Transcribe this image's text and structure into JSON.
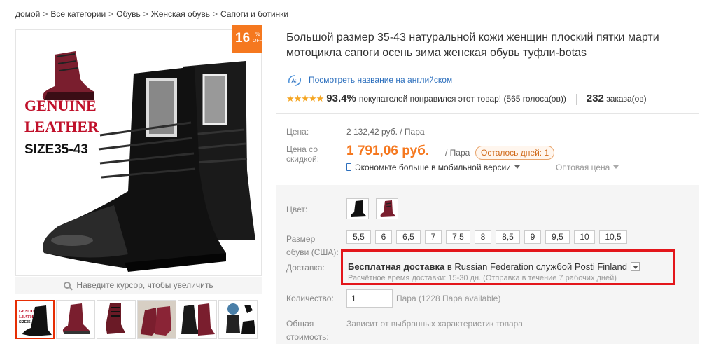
{
  "breadcrumb": [
    "домой",
    "Все категории",
    "Обувь",
    "Женская обувь",
    "Сапоги и ботинки"
  ],
  "product_image": {
    "text_lines": [
      "GENUINE",
      "LEATHER",
      "SIZE35-43"
    ],
    "zoom_hint": "Наведите курсор, чтобы увеличить"
  },
  "discount": {
    "value": "16",
    "unit": "%",
    "off": "OFF"
  },
  "thumb_text": [
    "GENUINE",
    "LEATHER",
    "SIZE35-43"
  ],
  "title": "Большой размер 35-43 натуральной кожи женщин плоский пятки марти мотоцикла сапоги осень зима женская обувь туфли-botas",
  "translate_link": "Посмотреть название на английском",
  "rating": {
    "percent": "93.4%",
    "text": "покупателей понравился этот товар! (565 голоса(ов))",
    "orders_count": "232",
    "orders_label": "заказа(ов)"
  },
  "price": {
    "label": "Цена:",
    "old": "2 132,42 руб. / Пара",
    "discount_label_1": "Цена со",
    "discount_label_2": "скидкой:",
    "new": "1 791,06 руб.",
    "unit": "/ Пара",
    "days_left": "Осталось дней: 1",
    "mobile": "Экономьте больше в мобильной версии",
    "wholesale": "Оптовая цена"
  },
  "color": {
    "label": "Цвет:"
  },
  "size": {
    "label_1": "Размер",
    "label_2": "обуви (США):",
    "options": [
      "5,5",
      "6",
      "6,5",
      "7",
      "7,5",
      "8",
      "8,5",
      "9",
      "9,5",
      "10",
      "10,5"
    ]
  },
  "delivery": {
    "label": "Доставка:",
    "free": "Бесплатная доставка",
    "in": "в",
    "destination": "Russian Federation",
    "service": "службой Posti Finland",
    "estimate": "Расчётное время доставки: 15-30 дн. (Отправка в течение 7 рабочих дней)"
  },
  "quantity": {
    "label": "Количество:",
    "value": "1",
    "note": "Пара (1228 Пара available)"
  },
  "total": {
    "label_1": "Общая",
    "label_2": "стоимость:",
    "note": "Зависит от выбранных характеристик товара"
  },
  "colors": {
    "accent": "#f5781f",
    "link": "#2c6fbd",
    "highlight_border": "#e3161b",
    "star": "#f5a623"
  }
}
